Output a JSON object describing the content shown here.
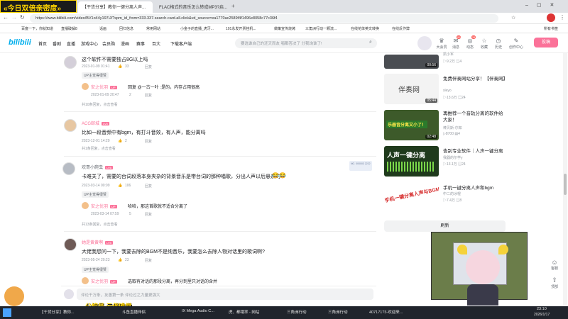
{
  "browser": {
    "tabs": [
      {
        "label": "【干货分享】教你一键分离人声..."
      },
      {
        "label": "FLAC格式的音乐怎么转成MP3?启..."
      }
    ],
    "url": "https://www.bilibili.com/video/BV1o44y197iJ/?spm_id_from=333.337.search-card.all.click&vd_source=ea1770ac2589f4f1496e8058c77c36f4",
    "bookmarks": [
      "百度一下，你就知道",
      "直播破解8",
      "话画",
      "回归信息",
      "常用网站",
      "小金子的直播_虎牙...",
      "101永发开票挂机...",
      "做策宣传烧烤",
      "三角洲行动一颗流...",
      "在线花体英文转换",
      "在线反作弊"
    ],
    "bookmarks_right": "所有书签"
  },
  "overlay": {
    "top_left_banner": "«今日双倍亲密度»",
    "bottom_left_banner": "公棕号 云伴唯党"
  },
  "bili": {
    "logo": "bilibili",
    "nav": [
      "首页",
      "番剧",
      "直播",
      "游戏中心",
      "会员购",
      "漫画",
      "赛事",
      "百大",
      "下载客户端"
    ],
    "search_placeholder": "要选谁自己的还天而友 唱都答决了 分我询谁了!",
    "right_icons": [
      {
        "label": "大会员",
        "icon": "vip-icon",
        "badge": ""
      },
      {
        "label": "消息",
        "icon": "message-icon",
        "badge": "99"
      },
      {
        "label": "动态",
        "icon": "dynamic-icon",
        "badge": "34"
      },
      {
        "label": "收藏",
        "icon": "favorite-icon",
        "badge": ""
      },
      {
        "label": "历史",
        "icon": "history-icon",
        "badge": ""
      },
      {
        "label": "创作中心",
        "icon": "creator-icon",
        "badge": ""
      }
    ],
    "upload": "投稿"
  },
  "comments": [
    {
      "text": "这个软件不需要独占8G以上吗",
      "date": "2023-01-09 01:41",
      "likes": "33",
      "reply": "回复"
    },
    {
      "up_tag": "UP主觉得很赞",
      "user": "安之优羽",
      "text": "回复 @一古一叶 :是的，内存占用很高",
      "date": "2023-01-09 20:47",
      "likes": "2",
      "reply": "回复",
      "more": "共10条回复，点击查看"
    },
    {
      "user": "ACG邮城",
      "text": "比如一段音频中有bgm，有打斗音效，有人声，能分离吗",
      "date": "2023-12-01 14:29",
      "likes": "2",
      "reply": "回复",
      "more": "共1条回复，点击查看"
    },
    {
      "user": "欢哥小爬虫",
      "text": "卡难关了，需要的台词段落本身夹杂的背景音乐是带台词的那种唱歌，分出人声以后悬杂的",
      "date": "2023-03-14 00:09",
      "likes": "106",
      "reply": "回复",
      "badge": "NO. 000003 2222"
    },
    {
      "up_tag": "UP主觉得很赞",
      "user": "安之优羽",
      "text": "哈哈，那这首歌就不适合分离了",
      "date": "2023-03-14 07:59",
      "likes": "5",
      "reply": "回复",
      "more": "共13条回复，点击查看"
    },
    {
      "user": "她是黄黄啊",
      "text": "大佬我想问一下，我要去除的BGM不是纯音乐，我要怎么去除人物对话里的歌词啊?",
      "date": "2023-05-24 20:23",
      "likes": "23",
      "reply": "回复"
    },
    {
      "up_tag": "UP主觉得很赞",
      "user": "安之优羽",
      "text": "选取有对话的那段分离，再分到里只对话的含并"
    }
  ],
  "comment_input_placeholder": "评论千万条，友善第一条  评论过之力量更强大",
  "sidebar_videos": [
    {
      "title": "",
      "up": "凯小军",
      "views": "9.2万",
      "danmaku": "4",
      "duration": "00:56"
    },
    {
      "title": "免费伴奏网站分享！【伴奏网】",
      "up": "sleyo",
      "views": "13.6万",
      "danmaku": "24",
      "duration": "05:44",
      "thumb_text": "伴奏网"
    },
    {
      "title": "再推荐一个音轨分离的软件给大家！",
      "up": "棒贝斯-尔知",
      "views": "8700",
      "danmaku": "4",
      "duration": "02:48",
      "thumb_text": "乐器音分离又小了！"
    },
    {
      "title": "告别专业软件｜人声一键分离",
      "up": "我器的尔学y",
      "views": "13.1万",
      "danmaku": "24",
      "duration": "",
      "thumb_text": "人声一键分离"
    },
    {
      "title": "手机一键分离人声和bgm",
      "up": "中二的冰棍",
      "views": "7.4万",
      "danmaku": "8",
      "duration": "",
      "thumb_text": "手机一键分离人声与BGM"
    }
  ],
  "refresh_button": "刷新",
  "float_buttons": [
    "客服",
    "顶部"
  ],
  "taskbar": {
    "items": [
      "【干货分享】教你...",
      "斗鱼直播伴侣",
      "IX Mega Audio C...",
      "虎、都哦率 - 网站",
      "三角洲行动",
      "三角洲行动",
      "407171?3-欢迎来..."
    ],
    "time": "23:10",
    "date": "2026/1/17"
  },
  "colors": {
    "accent": "#fb7299",
    "link": "#00aeec",
    "taskbar": "#20242c"
  }
}
